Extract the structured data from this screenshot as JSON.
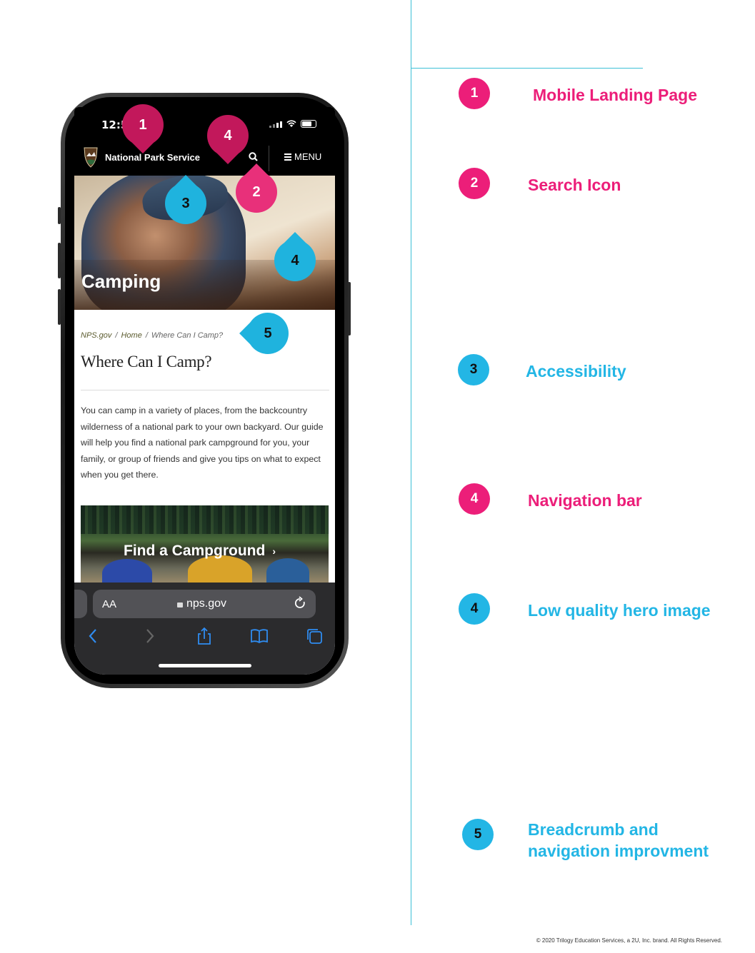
{
  "phone": {
    "status_time": "12:50",
    "site_brand": "National Park Service",
    "menu_label": "MENU",
    "hero_title": "Camping",
    "breadcrumb": [
      "NPS.gov",
      "Home",
      "Where Can I Camp?"
    ],
    "breadcrumb_sep": "/",
    "page_title": "Where Can I Camp?",
    "body_text": "You can camp in a variety of places, from the backcountry wilderness of a national park to your own backyard. Our guide will help you find a national park campground for you, your family, or group of friends and give you tips on what to expect when you get there.",
    "card_label": "Find a Campground",
    "card_chevron": "›",
    "address_aa": "AA",
    "address_url": "nps.gov"
  },
  "markers": [
    {
      "number": "1",
      "color": "#c2185b"
    },
    {
      "number": "4",
      "color": "#c2185b"
    },
    {
      "number": "2",
      "color": "#e8307a"
    },
    {
      "number": "3",
      "color": "#1fb3de"
    },
    {
      "number": "4",
      "color": "#1fb3de"
    },
    {
      "number": "5",
      "color": "#1fb3de"
    }
  ],
  "legend": [
    {
      "number": "1",
      "label": "Mobile Landing Page",
      "color": "pink"
    },
    {
      "number": "2",
      "label": "Search Icon",
      "color": "pink"
    },
    {
      "number": "3",
      "label": "Accessibility",
      "color": "blue"
    },
    {
      "number": "4",
      "label": "Navigation bar",
      "color": "pink"
    },
    {
      "number": "4",
      "label": "Low quality hero image",
      "color": "blue"
    },
    {
      "number": "5",
      "label_line1": "Breadcrumb and",
      "label_line2": "navigation  improvment",
      "color": "blue"
    }
  ],
  "footer": "© 2020 Trilogy Education Services, a 2U, Inc. brand. All Rights Reserved.",
  "colors": {
    "pink": "#ec1e79",
    "blue": "#23b6e5",
    "divider": "#3cc0d6"
  }
}
